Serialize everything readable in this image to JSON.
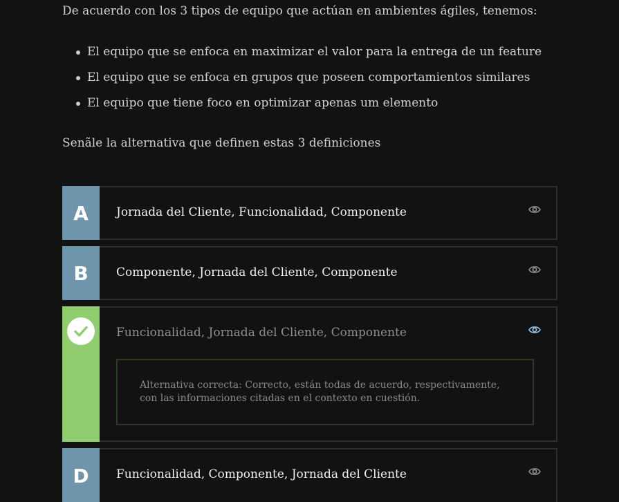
{
  "question": {
    "intro": "De acuerdo con los 3 tipos de equipo que actúan en ambientes ágiles, tenemos:",
    "bullets": [
      "El equipo que se enfoca en maximizar el valor para la entrega de un feature",
      "El equipo que se enfoca en grupos que poseen comportamientos similares",
      "El equipo que tiene foco en optimizar apenas um elemento"
    ],
    "prompt": "Senãle la alternativa que definen estas 3 definiciones"
  },
  "options": [
    {
      "letter": "A",
      "text": "Jornada del Cliente, Funcionalidad, Componente",
      "state": "default"
    },
    {
      "letter": "B",
      "text": "Componente, Jornada del Cliente, Componente",
      "state": "default"
    },
    {
      "letter": "C",
      "text": "Funcionalidad, Jornada del Cliente, Componente",
      "state": "correct",
      "feedback": "Alternativa correcta: Correcto, están todas de acuerdo, respectivamente, con las informaciones citadas en el contexto en cuestión."
    },
    {
      "letter": "D",
      "text": "Funcionalidad, Componente, Jornada del Cliente",
      "state": "default"
    }
  ],
  "icons": {
    "eye": "eye-icon",
    "check": "check-icon"
  },
  "colors": {
    "background": "#121212",
    "letter_badge": "#6f95ad",
    "correct": "#8fcd6f",
    "eye_highlight": "#8ab8d8"
  }
}
